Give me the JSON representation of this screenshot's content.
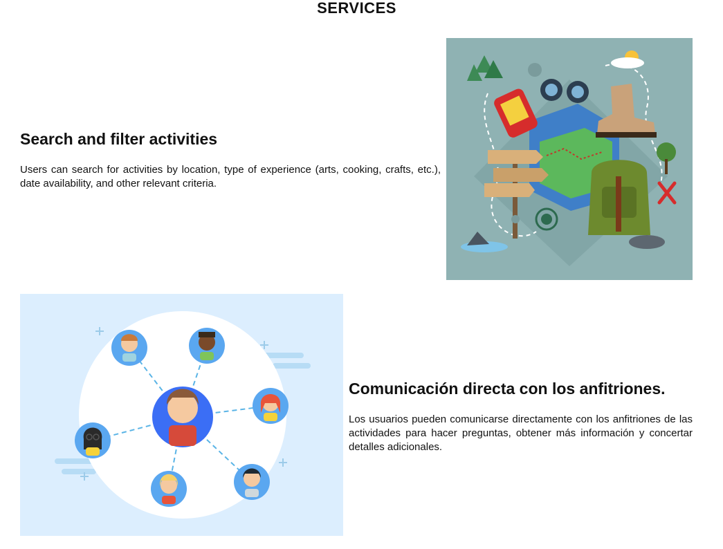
{
  "page": {
    "title": "SERVICES"
  },
  "services": [
    {
      "title": "Search and filter activities",
      "description": "Users can search for activities by location, type of experience (arts, cooking, crafts, etc.), date availability, and other relevant criteria.",
      "illustration_icon": "outdoor-travel-illustration"
    },
    {
      "title": "Comunicación directa con los anfitriones.",
      "description": "Los usuarios pueden comunicarse directamente con los anfitriones de las actividades para hacer preguntas, obtener más información y concertar detalles adicionales.",
      "illustration_icon": "user-network-illustration"
    }
  ],
  "colors": {
    "illustration_1_bg": "#8fb2b3",
    "illustration_2_bg": "#dceefe",
    "avatar_blue": "#3b82f6",
    "avatar_light_blue": "#5aa7f0"
  }
}
